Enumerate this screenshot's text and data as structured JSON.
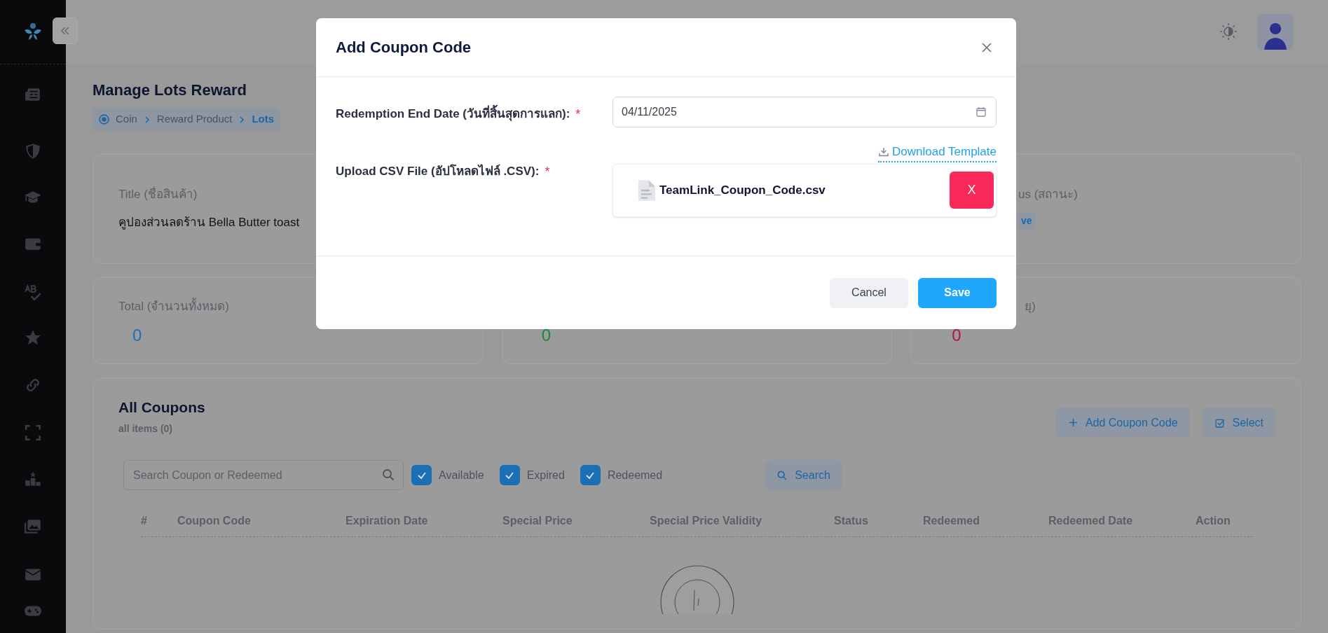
{
  "page_title": "Manage Lots Reward",
  "breadcrumb": [
    {
      "label": "Coin",
      "current": false
    },
    {
      "label": "Reward Product",
      "current": false
    },
    {
      "label": "Lots",
      "current": true
    }
  ],
  "product_info": {
    "title_label": "Title (ชื่อสินค้า)",
    "title_value": "คูปองส่วนลดร้าน Bella Butter toast",
    "status_label": "us (สถานะ)",
    "status_badge": "ve"
  },
  "stats": [
    {
      "label": "Total (จำนวนทั้งหมด)",
      "value": "0",
      "color": "#1a6fb8"
    },
    {
      "value": "0",
      "color": "#138a3c"
    },
    {
      "label": "ยุ)",
      "value": "0",
      "color": "#b0163c"
    }
  ],
  "coupons": {
    "title": "All Coupons",
    "subtitle": "all items (0)",
    "actions": [
      {
        "kind": "add",
        "label": "Add Coupon Code"
      },
      {
        "kind": "select",
        "label": "Select"
      }
    ],
    "search": {
      "placeholder": "Search Coupon or Redeemed"
    },
    "filters": [
      {
        "label": "Available",
        "checked": true
      },
      {
        "label": "Expired",
        "checked": true
      },
      {
        "label": "Redeemed",
        "checked": true
      }
    ],
    "search_button": "Search",
    "columns": [
      "#",
      "Coupon Code",
      "Expiration Date",
      "Special Price",
      "Special Price Validity",
      "Status",
      "Redeemed",
      "Redeemed Date",
      "Action"
    ]
  },
  "modal": {
    "title": "Add Coupon Code",
    "fields": [
      {
        "kind": "date",
        "label": "Redemption End Date (วันที่สิ้นสุดการแลก):",
        "required_mark": "*",
        "value": "04/11/2025"
      },
      {
        "kind": "file",
        "label": "Upload CSV File (อัปโหลดไฟล์ .CSV):",
        "required_mark": "*",
        "link": "Download Template",
        "file_name": "TeamLink_Coupon_Code.csv",
        "remove": "X"
      }
    ],
    "buttons": [
      {
        "kind": "secondary",
        "label": "Cancel"
      },
      {
        "kind": "primary",
        "label": "Save"
      }
    ]
  }
}
